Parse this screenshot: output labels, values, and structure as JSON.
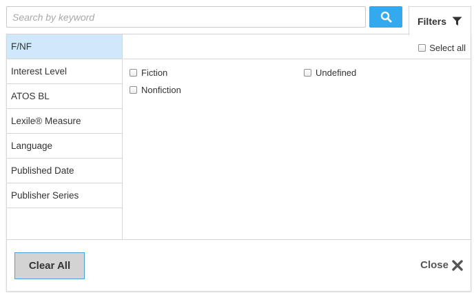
{
  "search": {
    "placeholder": "Search by keyword",
    "value": "",
    "button_icon": "search-icon"
  },
  "filters_tab": {
    "label": "Filters",
    "icon": "funnel-icon"
  },
  "sidebar": {
    "active_index": 0,
    "items": [
      {
        "label": "F/NF"
      },
      {
        "label": "Interest Level"
      },
      {
        "label": "ATOS BL"
      },
      {
        "label": "Lexile® Measure"
      },
      {
        "label": "Language"
      },
      {
        "label": "Published Date"
      },
      {
        "label": "Publisher Series"
      }
    ]
  },
  "content": {
    "select_all_label": "Select all",
    "options": [
      {
        "label": "Fiction",
        "checked": false
      },
      {
        "label": "Nonfiction",
        "checked": false
      },
      {
        "label": "Undefined",
        "checked": false
      }
    ]
  },
  "footer": {
    "clear_label": "Clear All",
    "close_label": "Close",
    "close_icon": "close-icon"
  },
  "colors": {
    "accent": "#34a9ee",
    "active_item": "#cfe9fb",
    "clear_button": "#d3d3d3",
    "border": "#d6d6d6"
  }
}
